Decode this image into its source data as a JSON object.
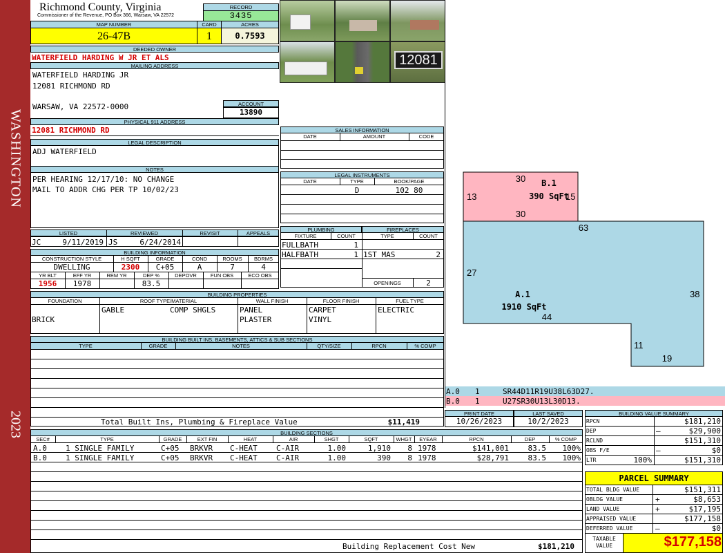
{
  "side": {
    "top": "WASHINGTON",
    "bottom": "2023"
  },
  "header": {
    "county": "Richmond County, Virginia",
    "commissioner": "Commissioner of the Revenue, PO Box 366, Warsaw, VA 22572",
    "record_label": "RECORD",
    "record": "3435",
    "map_label": "MAP NUMBER",
    "map": "26-47B",
    "card_label": "CARD",
    "card": "1",
    "acres_label": "ACRES",
    "acres": "0.7593"
  },
  "owner": {
    "deeded_label": "DEEDED OWNER",
    "deeded": "WATERFIELD HARDING W JR ET ALS",
    "mailing_label": "MAILING ADDRESS",
    "mail1": "WATERFIELD HARDING JR",
    "mail2": "12081 RICHMOND RD",
    "mail3": "WARSAW, VA 22572-0000",
    "account_label": "ACCOUNT",
    "account": "13890",
    "phys_label": "PHYSICAL 911 ADDRESS",
    "phys": "12081 RICHMOND RD",
    "legal_label": "LEGAL DESCRIPTION",
    "legal": "ADJ WATERFIELD",
    "notes_label": "NOTES",
    "note1": "PER HEARING 12/17/10: NO CHANGE",
    "note2": "MAIL TO ADDR CHG PER TP 10/02/23"
  },
  "photo_sign": "12081",
  "sales": {
    "title": "SALES INFORMATION",
    "cols": [
      "DATE",
      "AMOUNT",
      "CODE"
    ]
  },
  "legal_inst": {
    "title": "LEGAL INSTRUMENTS",
    "cols": [
      "DATE",
      "TYPE",
      "BOOK/PAGE"
    ],
    "type": "D",
    "book": "102 80"
  },
  "listed": {
    "listed_label": "LISTED",
    "reviewed_label": "REVIEWED",
    "revisit_label": "REVISIT",
    "appeals_label": "APPEALS",
    "lby": "JC",
    "ldate": "9/11/2019",
    "rby": "JS",
    "rdate": "6/24/2014"
  },
  "bldg_info": {
    "title": "BUILDING INFORMATION",
    "cols": [
      "CONSTRUCTION STYLE",
      "H SQFT",
      "GRADE",
      "COND",
      "ROOMS",
      "BDRMS"
    ],
    "vals": [
      "DWELLING",
      "2300",
      "C+05",
      "A",
      "7",
      "4"
    ],
    "cols2": [
      "YR BLT",
      "EFF YR",
      "REM YR",
      "DEP %",
      "DEPOVR",
      "FUN OBS",
      "ECO OBS"
    ],
    "vals2": [
      "1956",
      "1978",
      "",
      "83.5",
      "",
      "",
      ""
    ]
  },
  "plumbing": {
    "title": "PLUMBING",
    "cols": [
      "FIXTURE",
      "COUNT"
    ],
    "rows": [
      [
        "FULLBATH",
        "1"
      ],
      [
        "HALFBATH",
        "1"
      ]
    ]
  },
  "fireplaces": {
    "title": "FIREPLACES",
    "cols": [
      "TYPE",
      "COUNT"
    ],
    "rows": [
      [
        "1ST MAS",
        "2"
      ]
    ],
    "openings_label": "OPENINGS",
    "openings": "2"
  },
  "props": {
    "title": "BUILDING PROPERTIES",
    "cols": [
      "FOUNDATION",
      "ROOF TYPE/MATERIAL",
      "WALL FINISH",
      "FLOOR FINISH",
      "FUEL TYPE"
    ],
    "foundation": "BRICK",
    "roof1": "GABLE",
    "roof2": "COMP SHGLS",
    "wall1": "PANEL",
    "wall2": "PLASTER",
    "floor1": "CARPET",
    "floor2": "VINYL",
    "fuel": "ELECTRIC"
  },
  "builtins": {
    "title": "BUILDING BUILT INS, BASEMENTS, ATTICS & SUB SECTIONS",
    "cols": [
      "TYPE",
      "GRADE",
      "NOTES",
      "QTY/SIZE",
      "RPCN",
      "% COMP"
    ],
    "total_label": "Total Built Ins, Plumbing & Fireplace Value",
    "total": "$11,419"
  },
  "sketch": {
    "b_label": "B.1",
    "b_area": "390 SqFt",
    "a_label": "A.1",
    "a_area": "1910 SqFt",
    "dims": [
      "30",
      "13",
      "15",
      "30",
      "63",
      "27",
      "38",
      "44",
      "11",
      "19"
    ]
  },
  "codes": [
    {
      "id": "A.0",
      "n": "1",
      "code": "SR44D11R19U38L63D27."
    },
    {
      "id": "B.0",
      "n": "1",
      "code": "U27SR30U13L30D13."
    }
  ],
  "print": {
    "print_label": "PRINT DATE",
    "saved_label": "LAST SAVED",
    "print": "10/26/2023",
    "saved": "10/2/2023"
  },
  "sections": {
    "title": "BUILDING SECTIONS",
    "cols": [
      "SEC#",
      "TYPE",
      "GRADE",
      "EXT FIN",
      "HEAT",
      "AIR",
      "SHGT",
      "SQFT",
      "WHGT",
      "EYEAR",
      "RPCN",
      "DEP",
      "% COMP"
    ],
    "rows": [
      [
        "A.0",
        "1 SINGLE FAMILY",
        "C+05",
        "BRKVR",
        "C-HEAT",
        "C-AIR",
        "1.00",
        "1,910",
        "8",
        "1978",
        "$141,001",
        "83.5",
        "100%"
      ],
      [
        "B.0",
        "1 SINGLE FAMILY",
        "C+05",
        "BRKVR",
        "C-HEAT",
        "C-AIR",
        "1.00",
        "390",
        "8",
        "1978",
        "$28,791",
        "83.5",
        "100%"
      ]
    ],
    "total_label": "Building Replacement Cost New",
    "total": "$181,210"
  },
  "bvs": {
    "title": "BUILDING VALUE SUMMARY",
    "rpcn_label": "RPCN",
    "rpcn": "$181,210",
    "dep_label": "DEP",
    "dep_sign": "–",
    "dep": "$29,900",
    "rclnd_label": "RCLND",
    "rclnd": "$151,310",
    "obs_label": "OBS F/E",
    "obs_sign": "–",
    "obs": "$0",
    "ltr_label": "LTR",
    "ltr_pct": "100%",
    "ltr": "$151,310"
  },
  "parcel": {
    "title": "PARCEL SUMMARY",
    "total_bldg_label": "TOTAL BLDG VALUE",
    "total_bldg": "$151,311",
    "obldg_label": "OBLDG VALUE",
    "obldg_sign": "+",
    "obldg": "$8,653",
    "land_label": "LAND VALUE",
    "land_sign": "+",
    "land": "$17,195",
    "appraised_label": "APPRAISED VALUE",
    "appraised": "$177,158",
    "deferred_label": "DEFERRED VALUE",
    "deferred_sign": "–",
    "deferred": "$0",
    "taxable_label1": "TAXABLE",
    "taxable_label2": "VALUE",
    "taxable": "$177,158"
  }
}
